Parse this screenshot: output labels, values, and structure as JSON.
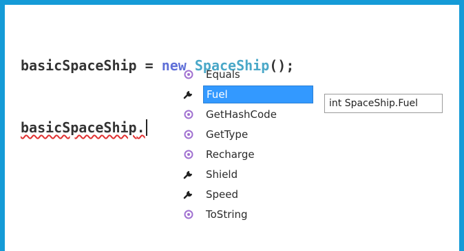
{
  "editor": {
    "line1": {
      "identifier": "basicSpaceShip",
      "operator": " = ",
      "keyword": "new",
      "type_name": "SpaceShip",
      "tail": "();"
    },
    "line2": {
      "identifier": "basicSpaceShip",
      "dot": "."
    }
  },
  "completion": {
    "selected_index": 1,
    "items": [
      {
        "label": "Equals",
        "kind": "method",
        "icon": "method-icon"
      },
      {
        "label": "Fuel",
        "kind": "property",
        "icon": "wrench-icon"
      },
      {
        "label": "GetHashCode",
        "kind": "method",
        "icon": "method-icon"
      },
      {
        "label": "GetType",
        "kind": "method",
        "icon": "method-icon"
      },
      {
        "label": "Recharge",
        "kind": "method",
        "icon": "method-icon"
      },
      {
        "label": "Shield",
        "kind": "property",
        "icon": "wrench-icon"
      },
      {
        "label": "Speed",
        "kind": "property",
        "icon": "wrench-icon"
      },
      {
        "label": "ToString",
        "kind": "method",
        "icon": "method-icon"
      }
    ]
  },
  "tooltip": {
    "text": "int SpaceShip.Fuel"
  },
  "colors": {
    "frame_border": "#159bd7",
    "keyword": "#6070d8",
    "type": "#4aa8c8",
    "selection": "#3399ff",
    "method_icon": "#a070d0"
  }
}
